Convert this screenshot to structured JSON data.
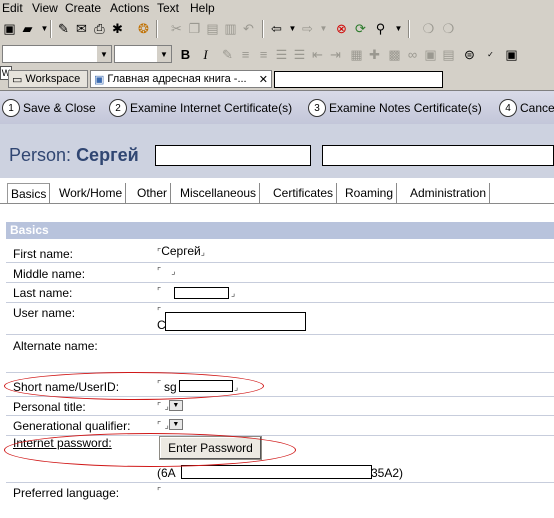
{
  "menu": [
    "Edit",
    "View",
    "Create",
    "Actions",
    "Text",
    "Help"
  ],
  "toolbar2": {
    "bold": "B",
    "italic": "I"
  },
  "window_tabs": [
    {
      "label": "Workspace"
    },
    {
      "label": "Главная адресная книга -..."
    }
  ],
  "actions": [
    {
      "num": "1",
      "label": "Save & Close"
    },
    {
      "num": "2",
      "label": "Examine Internet Certificate(s)"
    },
    {
      "num": "3",
      "label": "Examine Notes Certificate(s)"
    },
    {
      "num": "4",
      "label": "Cance"
    }
  ],
  "title": {
    "prefix": "Person:",
    "name": "Сергей"
  },
  "form_tabs": [
    "Basics",
    "Work/Home",
    "Other",
    "Miscellaneous",
    "Certificates",
    "Roaming",
    "Administration"
  ],
  "section": "Basics",
  "fields": {
    "first_name": {
      "label": "First name:",
      "value": "Сергей"
    },
    "middle_name": {
      "label": "Middle name:"
    },
    "last_name": {
      "label": "Last name:"
    },
    "user_name": {
      "label": "User name:",
      "value_prefix": "C"
    },
    "alternate_name": {
      "label": "Alternate name:"
    },
    "short_name": {
      "label": "Short name/UserID:",
      "value_prefix": "sg"
    },
    "personal_title": {
      "label": "Personal title:"
    },
    "generational_qualifier": {
      "label": "Generational qualifier:"
    },
    "internet_password": {
      "label": "Internet password:",
      "button": "Enter Password",
      "hash_prefix": "(6A",
      "hash_suffix": "35A2)"
    },
    "preferred_language": {
      "label": "Preferred language:"
    }
  },
  "colors": {
    "title": "#304672",
    "section_header": "#b8c3dc",
    "highlight": "#d01818"
  }
}
